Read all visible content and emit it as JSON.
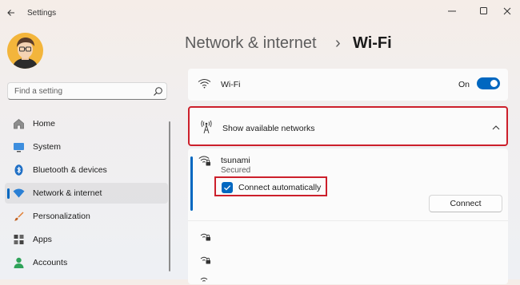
{
  "titlebar": {
    "app_title": "Settings"
  },
  "search": {
    "placeholder": "Find a setting"
  },
  "sidebar": {
    "items": [
      {
        "label": "Home",
        "icon": "home-icon"
      },
      {
        "label": "System",
        "icon": "monitor-icon"
      },
      {
        "label": "Bluetooth & devices",
        "icon": "bluetooth-icon"
      },
      {
        "label": "Network & internet",
        "icon": "wifi-icon",
        "active": true
      },
      {
        "label": "Personalization",
        "icon": "brush-icon"
      },
      {
        "label": "Apps",
        "icon": "apps-icon"
      },
      {
        "label": "Accounts",
        "icon": "person-icon"
      }
    ]
  },
  "header": {
    "parent": "Network & internet",
    "separator": "›",
    "current": "Wi-Fi"
  },
  "wifi": {
    "label": "Wi-Fi",
    "toggle_state": "On",
    "enabled": true
  },
  "networks": {
    "header_label": "Show available networks",
    "expanded": true,
    "selected": {
      "name": "tsunami",
      "status": "Secured",
      "connect_auto_label": "Connect automatically",
      "connect_auto_checked": true,
      "connect_button": "Connect"
    },
    "other_count": 3
  },
  "colors": {
    "accent": "#0067c0",
    "highlight": "#cc1f2b"
  }
}
